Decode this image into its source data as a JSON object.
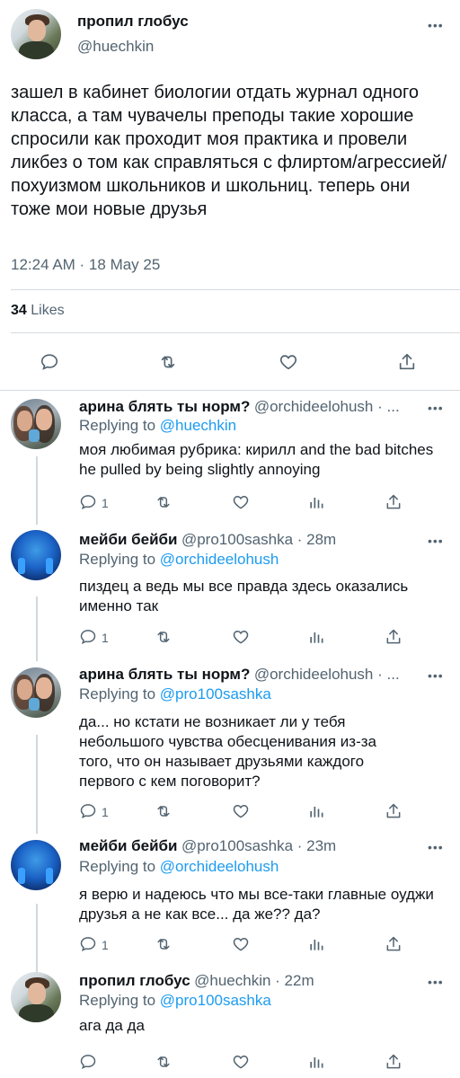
{
  "main": {
    "name": "пропил глобус",
    "handle": "@huechkin",
    "text": "зашел в кабинет биологии отдать журнал одного класса, а там чувачелы преподы такие хорошие спросили как проходит моя практика и провели ликбез о том как справляться с флиртом/агрессией/ похуизмом школьников и школьниц. теперь они тоже мои новые друзья",
    "timestamp": "12:24 AM · 18 May 25",
    "likes_count": "34",
    "likes_label": "Likes"
  },
  "replies": [
    {
      "name": "арина блять ты норм?",
      "handle": "@orchideelohush · ...",
      "replying_prefix": "Replying to ",
      "replying_to": "@huechkin",
      "text": "моя любимая рубрика: кирилл and the bad bitches he pulled by being slightly annoying",
      "reply_count": "1"
    },
    {
      "name": "мейби бейби",
      "handle": "@pro100sashka · 28m",
      "replying_prefix": "Replying to ",
      "replying_to": "@orchideelohush",
      "text": "пиздец а ведь мы все правда здесь оказались именно так",
      "reply_count": "1"
    },
    {
      "name": "арина блять ты норм?",
      "handle": "@orchideelohush · ...",
      "replying_prefix": "Replying to ",
      "replying_to": "@pro100sashka",
      "text": "да... но кстати не возникает ли у тебя небольшого чувства обесценивания из-за того, что он называет друзьями каждого первого с кем поговорит?",
      "reply_count": "1"
    },
    {
      "name": "мейби бейби",
      "handle": "@pro100sashka · 23m",
      "replying_prefix": "Replying to ",
      "replying_to": "@orchideelohush",
      "text": "я верю и надеюсь что мы все-таки главные оуджи друзья а не как все... да же?? да?",
      "reply_count": "1"
    },
    {
      "name": "пропил глобус",
      "handle": "@huechkin · 22m",
      "replying_prefix": "Replying to ",
      "replying_to": "@pro100sashka",
      "text": "ага да да",
      "reply_count": ""
    }
  ],
  "more_label": "•••",
  "colors": {
    "link": "#1d9bf0",
    "secondary": "#536471",
    "divider": "#d5dbe0"
  },
  "icons": [
    "reply-icon",
    "retweet-icon",
    "like-icon",
    "share-icon",
    "analytics-icon",
    "more-icon"
  ]
}
